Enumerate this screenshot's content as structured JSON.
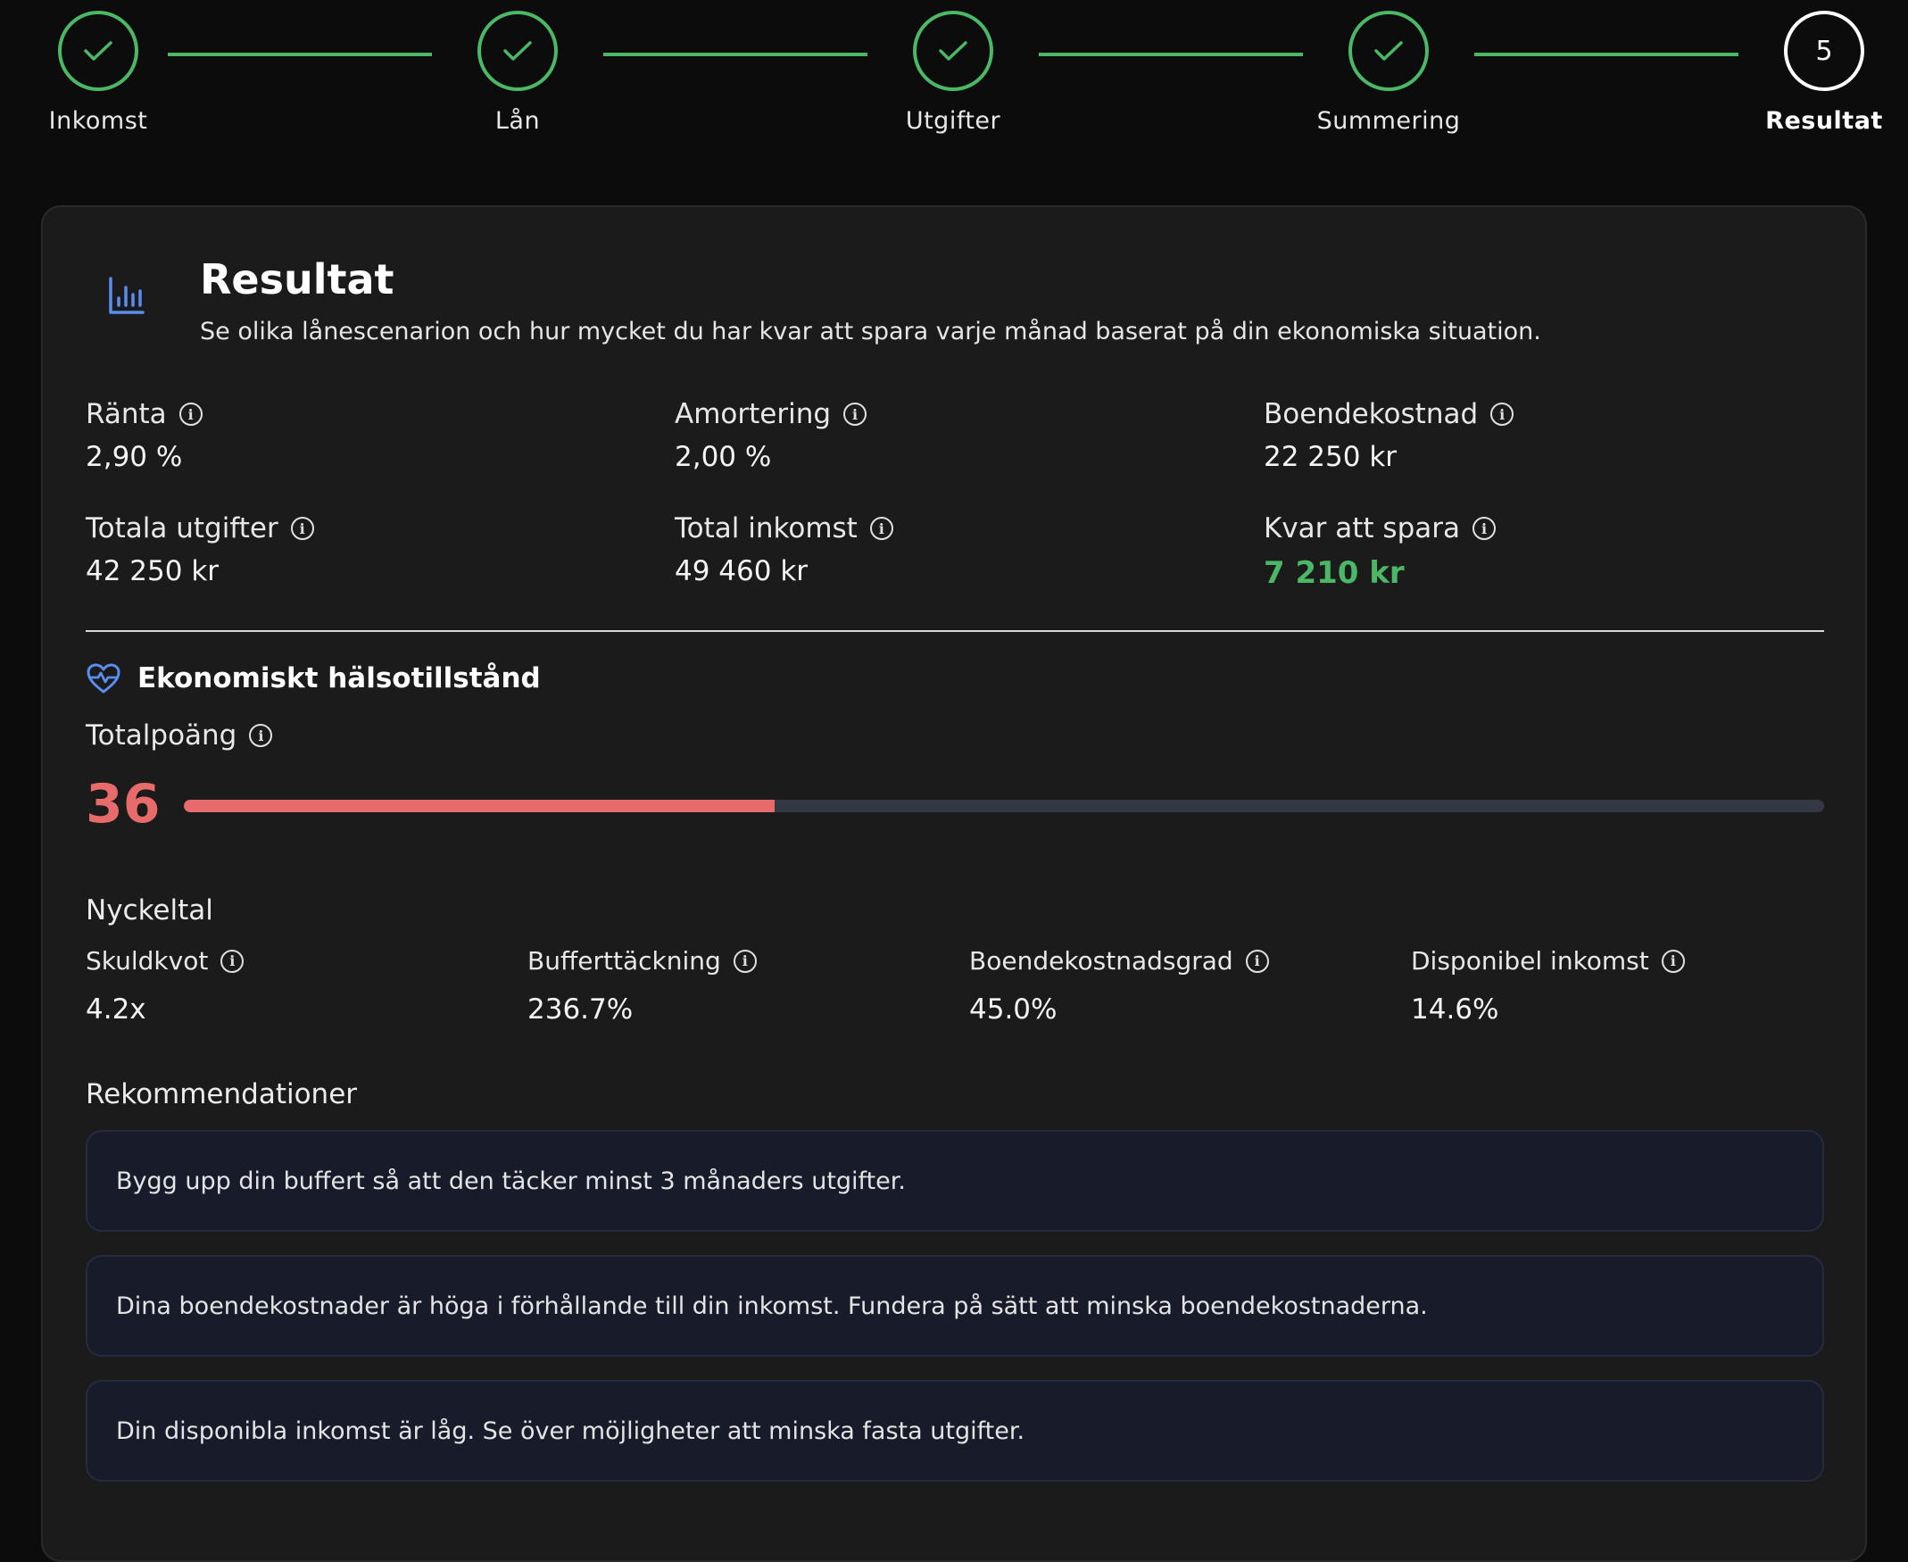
{
  "stepper": {
    "steps": [
      {
        "label": "Inkomst",
        "status": "done"
      },
      {
        "label": "Lån",
        "status": "done"
      },
      {
        "label": "Utgifter",
        "status": "done"
      },
      {
        "label": "Summering",
        "status": "done"
      },
      {
        "label": "Resultat",
        "status": "current",
        "number": "5"
      }
    ],
    "done_color": "#4bb865"
  },
  "result": {
    "title": "Resultat",
    "description": "Se olika lånescenarion och hur mycket du har kvar att spara varje månad baserat på din ekonomiska situation.",
    "stats": {
      "ranta": {
        "label": "Ränta",
        "value": "2,90 %"
      },
      "amortering": {
        "label": "Amortering",
        "value": "2,00 %"
      },
      "boendekostnad": {
        "label": "Boendekostnad",
        "value": "22 250 kr"
      },
      "totala_utgifter": {
        "label": "Totala utgifter",
        "value": "42 250 kr"
      },
      "total_inkomst": {
        "label": "Total inkomst",
        "value": "49 460 kr"
      },
      "kvar_att_spara": {
        "label": "Kvar att spara",
        "value": "7 210 kr"
      }
    }
  },
  "health": {
    "title": "Ekonomiskt hälsotillstånd",
    "total_label": "Totalpoäng",
    "score": "36",
    "score_fraction": 0.36,
    "score_color": "#e86b6b",
    "key_figures_label": "Nyckeltal",
    "kpis": {
      "skuldkvot": {
        "label": "Skuldkvot",
        "value": "4.2x"
      },
      "bufferttackning": {
        "label": "Bufferttäckning",
        "value": "236.7%"
      },
      "boendekostnadsgrad": {
        "label": "Boendekostnadsgrad",
        "value": "45.0%"
      },
      "disponibel_inkomst": {
        "label": "Disponibel inkomst",
        "value": "14.6%"
      }
    },
    "recommendations_label": "Rekommendationer",
    "recommendations": [
      "Bygg upp din buffert så att den täcker minst 3 månaders utgifter.",
      "Dina boendekostnader är höga i förhållande till din inkomst. Fundera på sätt att minska boendekostnaderna.",
      "Din disponibla inkomst är låg. Se över möjligheter att minska fasta utgifter."
    ]
  }
}
